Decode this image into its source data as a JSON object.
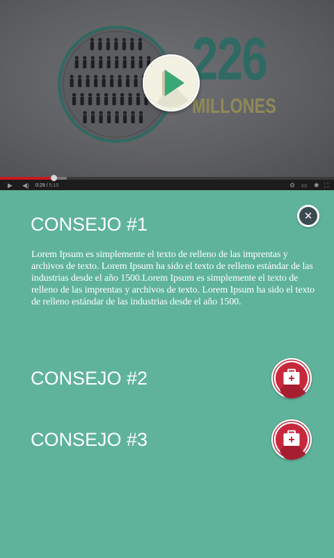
{
  "video": {
    "infographic_number": "226",
    "infographic_unit": "MILLONES",
    "current_time": "0:29",
    "duration": "5:15",
    "progress_fraction": 0.16,
    "buffered_fraction": 0.2,
    "colors": {
      "number": "#2e6a63",
      "unit": "#8f8a55",
      "play_triangle": "#3aa776",
      "progress": "#cc181e"
    },
    "icons": [
      "play-icon",
      "volume-icon",
      "settings-icon",
      "captions-icon",
      "gear-icon",
      "fullscreen-icon"
    ]
  },
  "tips": [
    {
      "title": "CONSEJO #1",
      "expanded": true,
      "body": "Lorem Ipsum es simplemente el texto de relleno de las imprentas y archivos de texto. Lorem Ipsum ha sido el texto de relleno estándar de las industrias desde el año 1500.Lorem Ipsum es simplemente el texto de relleno de las imprentas y archivos de texto. Lorem Ipsum ha sido el texto de relleno estándar de las industrias desde el año 1500.",
      "action_icon": "close-icon"
    },
    {
      "title": "CONSEJO #2",
      "expanded": false,
      "action_icon": "first-aid-kit-icon"
    },
    {
      "title": "CONSEJO #3",
      "expanded": false,
      "action_icon": "first-aid-kit-icon"
    }
  ],
  "colors": {
    "background": "#5fb39b",
    "kit_red": "#c8283c",
    "close_dark": "#3b4a4f"
  }
}
